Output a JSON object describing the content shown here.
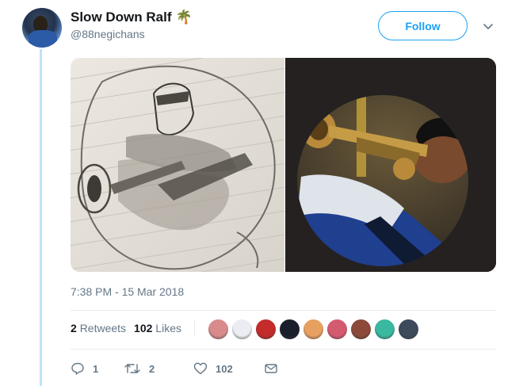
{
  "tweet": {
    "display_name": "Slow Down Ralf",
    "emoji": "🌴",
    "handle": "@88negichans",
    "follow_label": "Follow",
    "timestamp": "7:38 PM - 15 Mar 2018"
  },
  "stats": {
    "retweets_count": "2",
    "retweets_label": "Retweets",
    "likes_count": "102",
    "likes_label": "Likes"
  },
  "liker_colors": [
    "#d98b8b",
    "#ececf3",
    "#c42b2b",
    "#1a1f2b",
    "#e8a060",
    "#d45a70",
    "#8b4a3a",
    "#3bb8a0",
    "#3d4a5c"
  ],
  "actions": {
    "reply_count": "1",
    "retweet_count": "2",
    "like_count": "102"
  },
  "icons": {
    "chevron": "chevron-down-icon",
    "reply": "reply-icon",
    "retweet": "retweet-icon",
    "like": "heart-icon",
    "message": "envelope-icon"
  },
  "colors": {
    "accent": "#1da1f2",
    "muted": "#657786",
    "thread": "#bfe3f7"
  }
}
